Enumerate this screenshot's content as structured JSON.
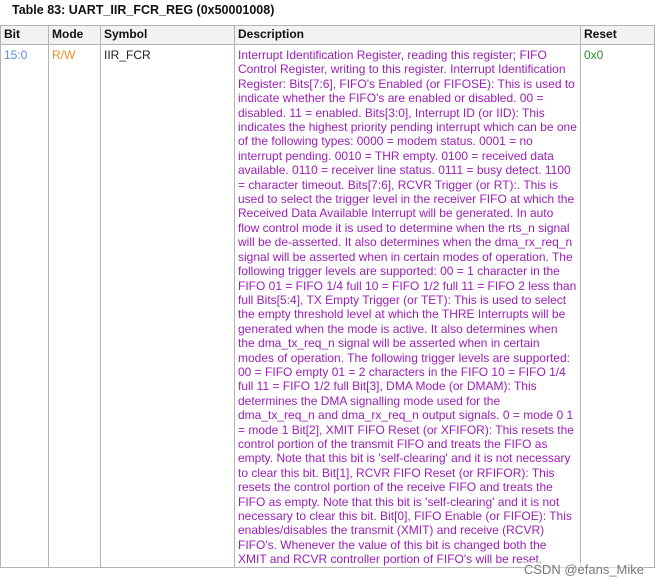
{
  "caption": "Table 83: UART_IIR_FCR_REG (0x50001008)",
  "columns": {
    "bit": "Bit",
    "mode": "Mode",
    "symbol": "Symbol",
    "description": "Description",
    "reset": "Reset"
  },
  "row": {
    "bit": "15:0",
    "mode": "R/W",
    "symbol": "IIR_FCR",
    "description": "Interrupt Identification Register, reading this register; FIFO Control Register, writing to this register. Interrupt Identification Register: Bits[7:6], FIFO's Enabled (or FIFOSE): This is used to indicate whether the FIFO's are enabled or disabled. 00 = disabled. 11 = enabled. Bits[3:0], Interrupt ID (or IID): This indicates the highest priority pending interrupt which can be one of the following types: 0000 = modem status. 0001 = no interrupt pending. 0010 = THR empty. 0100 = received data available. 0110 = receiver line status. 0111 = busy detect. 1100 = character timeout. Bits[7:6], RCVR Trigger (or RT):. This is used to select the trigger level in the receiver FIFO at which the Received Data Available Interrupt will be generated. In auto flow control mode it is used to determine when the rts_n signal will be de-asserted. It also determines when the dma_rx_req_n signal will be asserted when in certain modes of operation. The following trigger levels are supported: 00 = 1 character in the FIFO 01 = FIFO 1/4 full 10 = FIFO 1/2 full 11 = FIFO 2 less than full Bits[5:4], TX Empty Trigger (or TET): This is used to select the empty threshold level at which the THRE Interrupts will be generated when the mode is active. It also determines when the dma_tx_req_n signal will be asserted when in certain modes of operation. The following trigger levels are supported: 00 = FIFO empty 01 = 2 characters in the FIFO 10 = FIFO 1/4 full 11 = FIFO 1/2 full Bit[3], DMA Mode (or DMAM): This determines the DMA signalling mode used for the dma_tx_req_n and dma_rx_req_n output signals. 0 = mode 0 1 = mode 1 Bit[2], XMIT FIFO Reset (or XFIFOR): This resets the control portion of the transmit FIFO and treats the FIFO as empty. Note that this bit is 'self-clearing' and it is not necessary to clear this bit. Bit[1], RCVR FIFO Reset (or RFIFOR): This resets the control portion of the receive FIFO and treats the FIFO as empty. Note that this bit is 'self-clearing' and it is not necessary to clear this bit. Bit[0], FIFO Enable (or FIFOE): This enables/disables the transmit (XMIT) and receive (RCVR) FIFO's. Whenever the value of this bit is changed both the XMIT and RCVR controller portion of FIFO's will be reset.",
    "reset": "0x0"
  },
  "watermark": "CSDN @efans_Mike",
  "colors": {
    "bit": "#5b8ed6",
    "mode": "#f28c28",
    "description": "#9b1fb5",
    "reset": "#2e8b2e",
    "header_bg": "#f2f2f2",
    "border": "#b3b3b3"
  }
}
